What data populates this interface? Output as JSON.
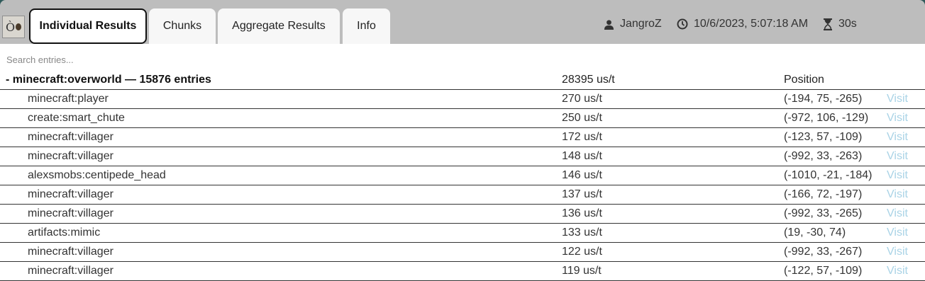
{
  "header": {
    "logo_text": "Ò",
    "tabs": [
      {
        "label": "Individual Results",
        "active": true
      },
      {
        "label": "Chunks",
        "active": false
      },
      {
        "label": "Aggregate Results",
        "active": false
      },
      {
        "label": "Info",
        "active": false
      }
    ],
    "user": "JangroZ",
    "timestamp": "10/6/2023, 5:07:18 AM",
    "duration": "30s"
  },
  "search": {
    "placeholder": "Search entries..."
  },
  "group": {
    "label": "- minecraft:overworld — 15876 entries",
    "time": "28395 us/t",
    "position_header": "Position"
  },
  "rows": [
    {
      "name": "minecraft:player",
      "time": "270 us/t",
      "pos": "(-194, 75, -265)",
      "visit": "Visit"
    },
    {
      "name": "create:smart_chute",
      "time": "250 us/t",
      "pos": "(-972, 106, -129)",
      "visit": "Visit"
    },
    {
      "name": "minecraft:villager",
      "time": "172 us/t",
      "pos": "(-123, 57, -109)",
      "visit": "Visit"
    },
    {
      "name": "minecraft:villager",
      "time": "148 us/t",
      "pos": "(-992, 33, -263)",
      "visit": "Visit"
    },
    {
      "name": "alexsmobs:centipede_head",
      "time": "146 us/t",
      "pos": "(-1010, -21, -184)",
      "visit": "Visit"
    },
    {
      "name": "minecraft:villager",
      "time": "137 us/t",
      "pos": "(-166, 72, -197)",
      "visit": "Visit"
    },
    {
      "name": "minecraft:villager",
      "time": "136 us/t",
      "pos": "(-992, 33, -265)",
      "visit": "Visit"
    },
    {
      "name": "artifacts:mimic",
      "time": "133 us/t",
      "pos": "(19, -30, 74)",
      "visit": "Visit"
    },
    {
      "name": "minecraft:villager",
      "time": "122 us/t",
      "pos": "(-992, 33, -267)",
      "visit": "Visit"
    },
    {
      "name": "minecraft:villager",
      "time": "119 us/t",
      "pos": "(-122, 57, -109)",
      "visit": "Visit"
    }
  ]
}
